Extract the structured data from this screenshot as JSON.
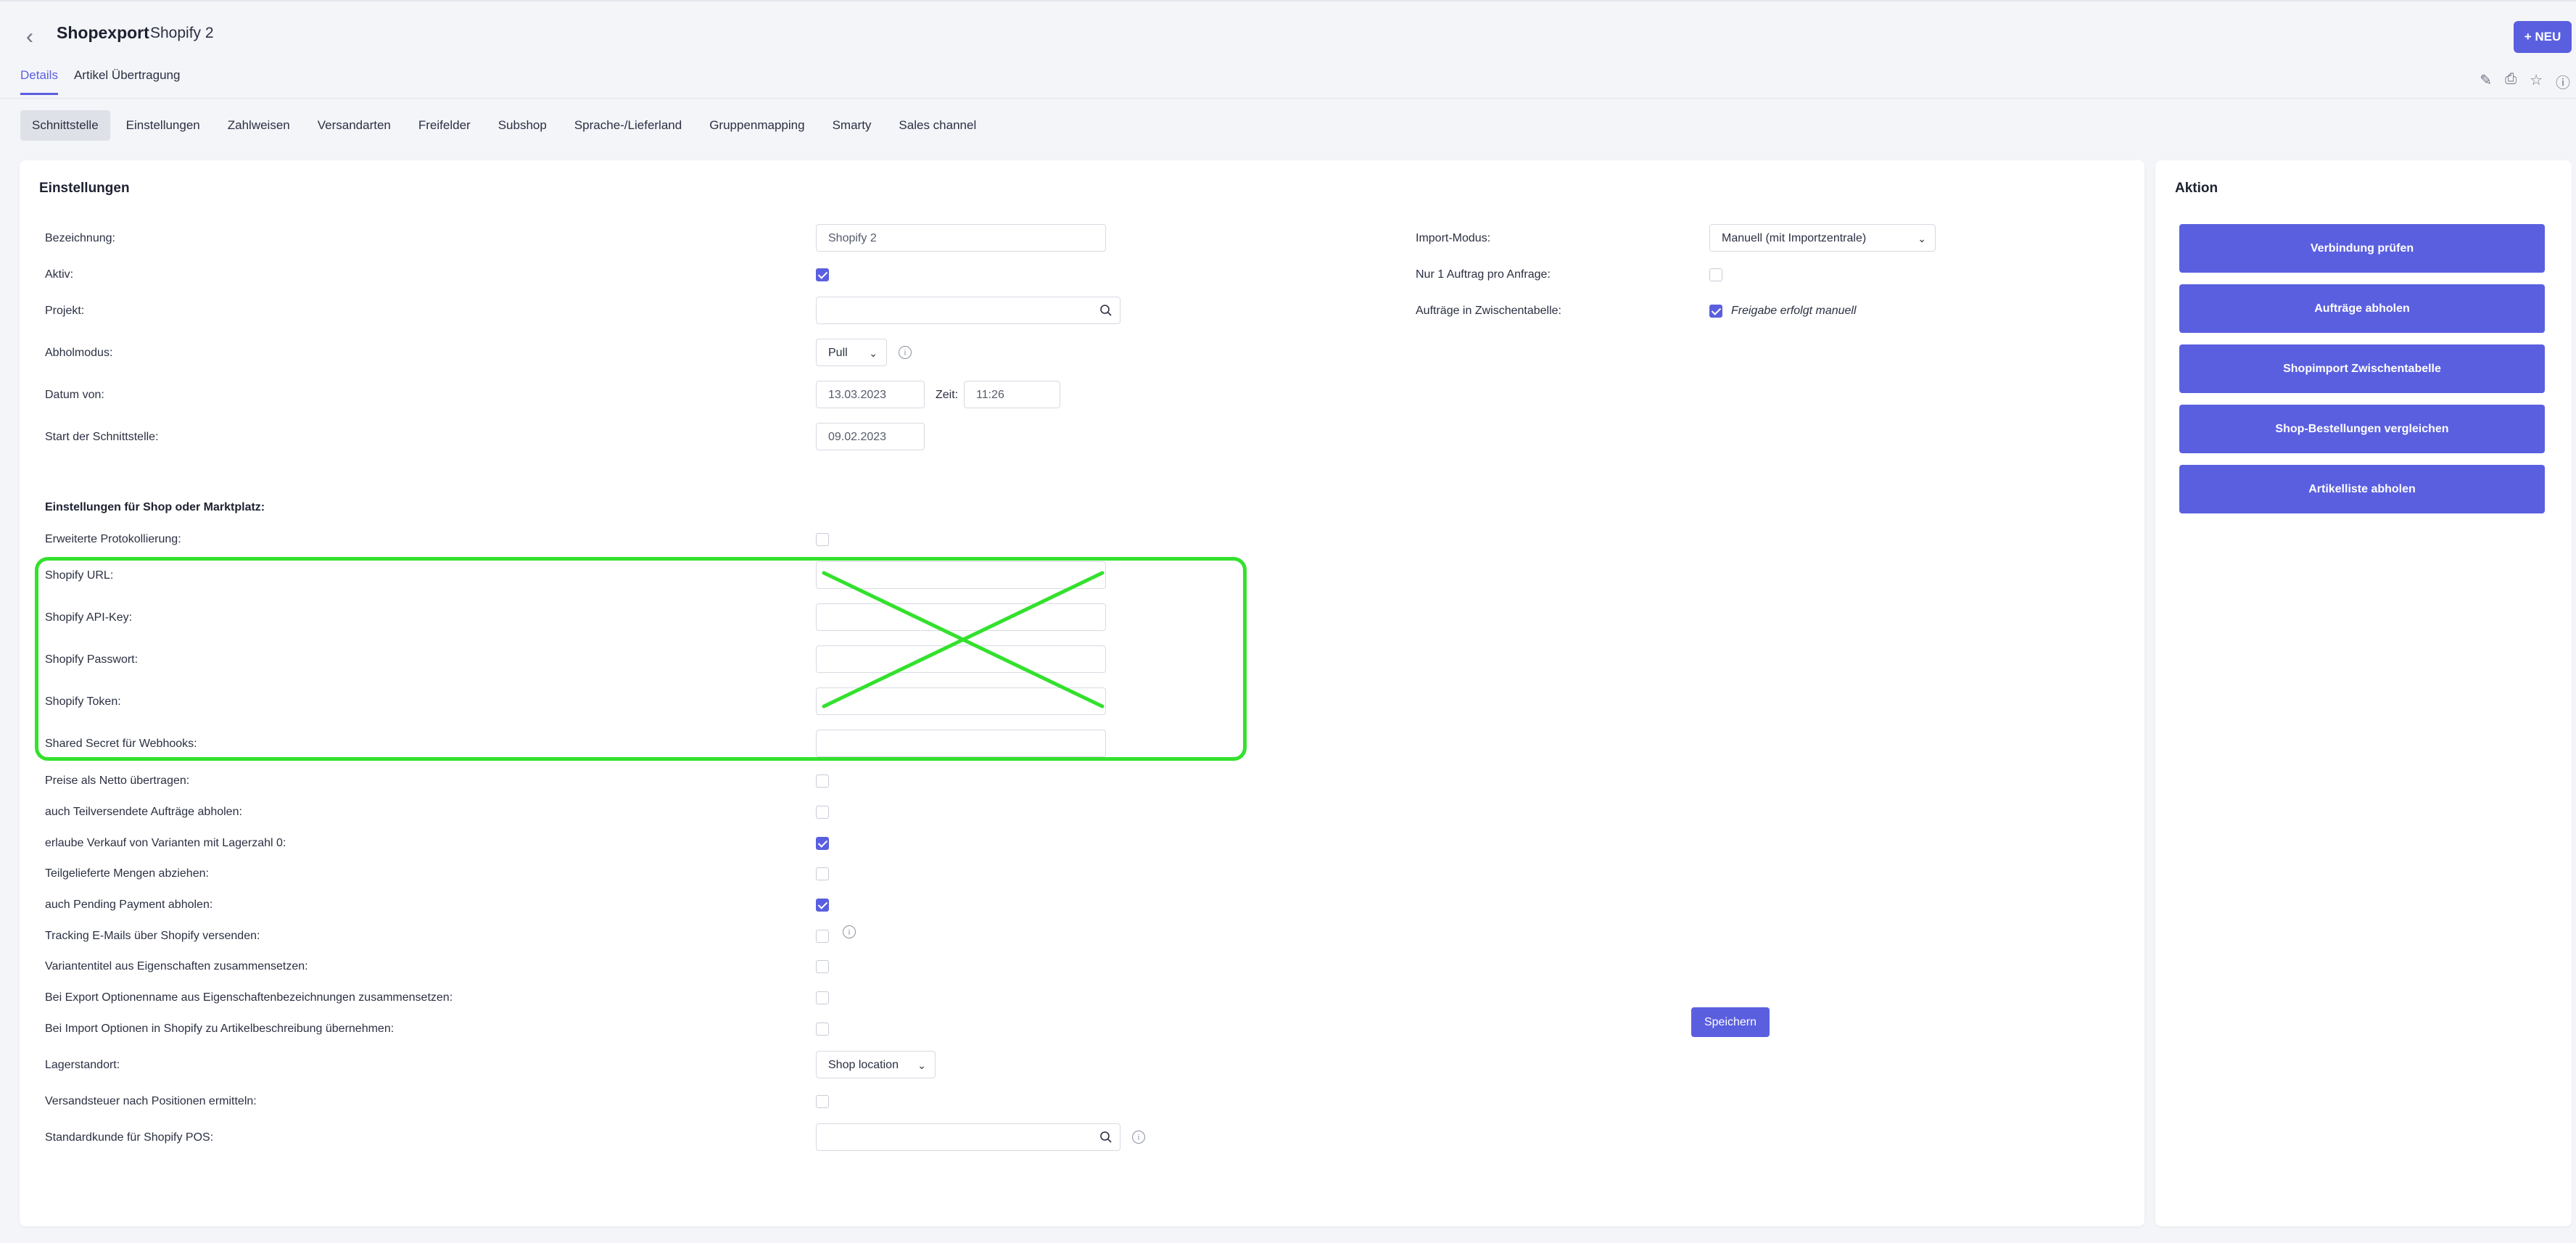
{
  "header": {
    "title": "Shopexport",
    "subtitle": "Shopify 2",
    "new_button": "+ NEU",
    "tabs": [
      "Details",
      "Artikel Übertragung"
    ]
  },
  "subtabs": [
    "Schnittstelle",
    "Einstellungen",
    "Zahlweisen",
    "Versandarten",
    "Freifelder",
    "Subshop",
    "Sprache-/Lieferland",
    "Gruppenmapping",
    "Smarty",
    "Sales channel"
  ],
  "settings": {
    "title": "Einstellungen",
    "bezeichnung_label": "Bezeichnung:",
    "bezeichnung_value": "Shopify 2",
    "aktiv_label": "Aktiv:",
    "projekt_label": "Projekt:",
    "abholmodus_label": "Abholmodus:",
    "abholmodus_value": "Pull",
    "datum_label": "Datum von:",
    "datum_value": "13.03.2023",
    "zeit_label": "Zeit:",
    "zeit_value": "11:26",
    "start_label": "Start der Schnittstelle:",
    "start_value": "09.02.2023",
    "import_modus_label": "Import-Modus:",
    "import_modus_value": "Manuell (mit Importzentrale)",
    "nur1_label": "Nur 1 Auftrag pro Anfrage:",
    "zwischentabelle_label": "Aufträge in Zwischentabelle:",
    "zwischentabelle_note": "Freigabe erfolgt manuell"
  },
  "shop_section": {
    "title": "Einstellungen für Shop oder Marktplatz:",
    "erweiterte_label": "Erweiterte Protokollierung:",
    "url_label": "Shopify URL:",
    "apikey_label": "Shopify API-Key:",
    "passwort_label": "Shopify Passwort:",
    "token_label": "Shopify Token:",
    "secret_label": "Shared Secret für Webhooks:",
    "netto_label": "Preise als Netto übertragen:",
    "teilversendete_label": "auch Teilversendete Aufträge abholen:",
    "varianten_label": "erlaube Verkauf von Varianten mit Lagerzahl 0:",
    "teilgelieferte_label": "Teilgelieferte Mengen abziehen:",
    "pending_label": "auch Pending Payment abholen:",
    "tracking_label": "Tracking E-Mails über Shopify versenden:",
    "variantentitel_label": "Variantentitel aus Eigenschaften zusammensetzen:",
    "export_label": "Bei Export Optionenname aus Eigenschaftenbezeichnungen zusammensetzen:",
    "import_label": "Bei Import Optionen in Shopify zu Artikelbeschreibung übernehmen:",
    "lager_label": "Lagerstandort:",
    "lager_value": "Shop location",
    "versandsteuer_label": "Versandsteuer nach Positionen ermitteln:",
    "pos_label": "Standardkunde für Shopify POS:"
  },
  "checkboxes": {
    "aktiv": true,
    "nur1": false,
    "zwischentabelle": true,
    "erweiterte": false,
    "netto": false,
    "teilversendete": false,
    "varianten": true,
    "teilgelieferte": false,
    "pending": true,
    "tracking": false,
    "variantentitel": false,
    "export": false,
    "import": false,
    "versandsteuer": false
  },
  "save_button": "Speichern",
  "aktion": {
    "title": "Aktion",
    "buttons": [
      "Verbindung prüfen",
      "Aufträge abholen",
      "Shopimport Zwischentabelle",
      "Shop-Bestellungen vergleichen",
      "Artikelliste abholen"
    ]
  },
  "colors": {
    "accent": "#5a5fe0",
    "highlight": "#33e12d"
  }
}
